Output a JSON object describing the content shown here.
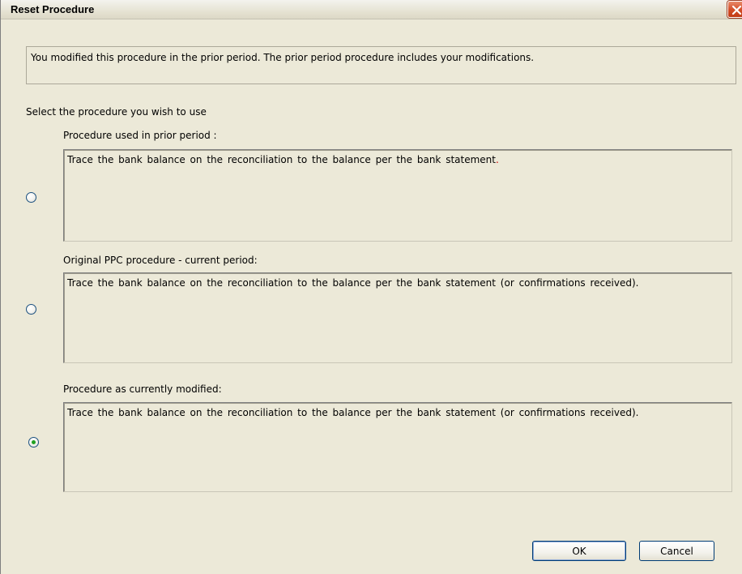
{
  "dialog": {
    "title": "Reset Procedure",
    "message": "You modified this procedure in the prior period. The prior period procedure includes your modifications.",
    "select_label": "Select the procedure you wish to use"
  },
  "options": [
    {
      "label": "Procedure used in prior period :",
      "text": "Trace the bank balance on the reconciliation to the balance per the bank statement",
      "trailing": ".",
      "selected": false
    },
    {
      "label": "Original PPC procedure - current period:",
      "text": "Trace the bank balance on the reconciliation to the balance per the bank statement (or confirmations received).",
      "trailing": "",
      "selected": false
    },
    {
      "label": "Procedure as currently modified:",
      "text": "Trace the bank balance on the reconciliation to the balance per the bank statement (or confirmations received).",
      "trailing": "",
      "selected": true
    }
  ],
  "buttons": {
    "ok_label": "OK",
    "cancel_label": "Cancel"
  },
  "icons": {
    "close": "close-icon"
  },
  "colors": {
    "close_button": "#d24b25",
    "radio_selected_dot": "#21a121",
    "trailing_period": "#d00000"
  }
}
